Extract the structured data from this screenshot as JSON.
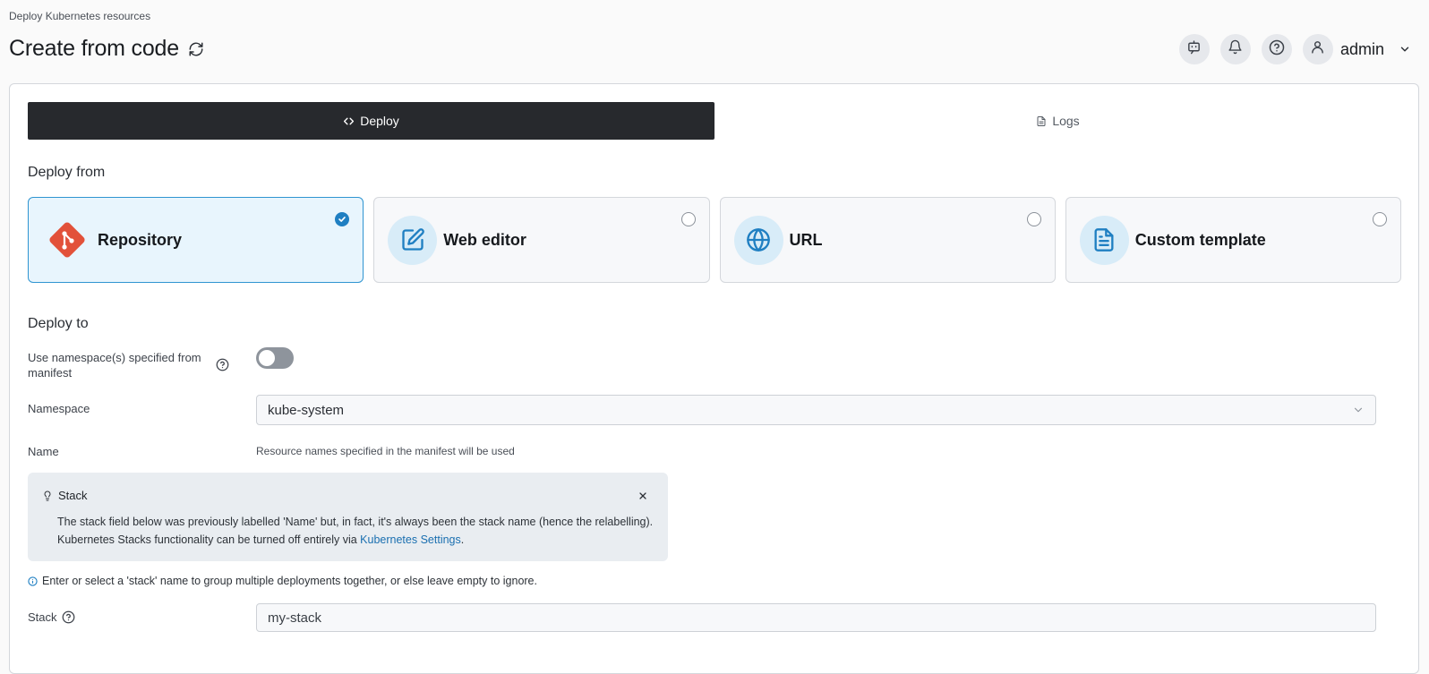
{
  "breadcrumb": "Deploy Kubernetes resources",
  "page_title": "Create from code",
  "user": {
    "name": "admin"
  },
  "tabs": [
    {
      "label": "Deploy",
      "active": true
    },
    {
      "label": "Logs",
      "active": false
    }
  ],
  "deploy_from": {
    "title": "Deploy from",
    "options": [
      {
        "label": "Repository",
        "icon": "git-icon",
        "selected": true
      },
      {
        "label": "Web editor",
        "icon": "edit-icon",
        "selected": false
      },
      {
        "label": "URL",
        "icon": "globe-icon",
        "selected": false
      },
      {
        "label": "Custom template",
        "icon": "file-text-icon",
        "selected": false
      }
    ]
  },
  "deploy_to": {
    "title": "Deploy to",
    "use_namespace_label": "Use namespace(s) specified from manifest",
    "use_namespace_enabled": false,
    "namespace_label": "Namespace",
    "namespace_value": "kube-system",
    "name_label": "Name",
    "name_hint": "Resource names specified in the manifest will be used"
  },
  "alert": {
    "title": "Stack",
    "line1": "The stack field below was previously labelled 'Name' but, in fact, it's always been the stack name (hence the relabelling).",
    "line2_prefix": "Kubernetes Stacks functionality can be turned off entirely via ",
    "line2_link": "Kubernetes Settings",
    "line2_suffix": "."
  },
  "info_text": "Enter or select a 'stack' name to group multiple deployments together, or else leave empty to ignore.",
  "stack": {
    "label": "Stack",
    "value": "my-stack"
  },
  "colors": {
    "accent": "#1f7fc2",
    "active_tab": "#27292d",
    "git": "#e2513a"
  }
}
